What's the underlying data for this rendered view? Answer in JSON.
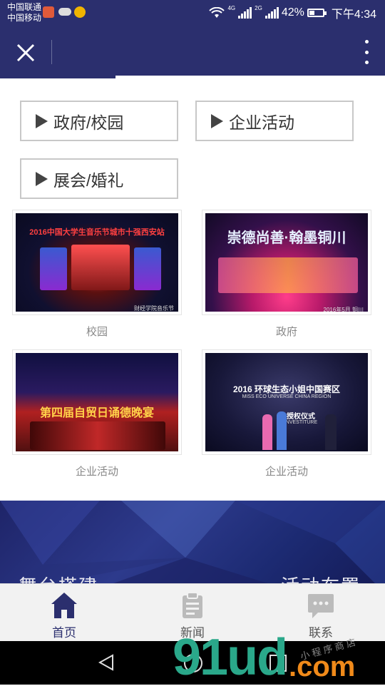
{
  "status_bar": {
    "carrier1": "中国联通",
    "carrier2": "中国移动",
    "net1": "4G",
    "net2": "2G",
    "battery": "42%",
    "battery_level": 0.42,
    "time": "下午4:34"
  },
  "nav": {
    "close_icon": "close-icon",
    "more_icon": "more-vertical-icon"
  },
  "categories": [
    {
      "label": "政府/校园",
      "icon": "play-triangle-icon"
    },
    {
      "label": "企业活动",
      "icon": "play-triangle-icon"
    },
    {
      "label": "展会/婚礼",
      "icon": "play-triangle-icon"
    }
  ],
  "gallery": [
    {
      "caption": "校园",
      "photo_text": "2016中国大学生音乐节城市十强西安站",
      "photo_sub": "财经学院音乐节"
    },
    {
      "caption": "政府",
      "photo_text": "崇德尚善·翰墨铜川",
      "photo_sub": "2016年5月 铜川"
    },
    {
      "caption": "企业活动",
      "photo_text": "第四届自贸日诵德晚宴",
      "photo_sub": ""
    },
    {
      "caption": "企业活动",
      "photo_text": "2016 环球生态小姐中国赛区",
      "photo_sub": "MISS ECO UNIVERSE CHINA REGION",
      "photo_sub2": "授权仪式",
      "photo_sub3": "INVESTITURE"
    }
  ],
  "banner": {
    "left_text": "舞台搭建",
    "right_text": "活动布置"
  },
  "tabs": [
    {
      "label": "首页",
      "icon": "home-icon",
      "active": true
    },
    {
      "label": "新闻",
      "icon": "clipboard-icon",
      "active": false
    },
    {
      "label": "联系",
      "icon": "chat-bubble-icon",
      "active": false
    }
  ],
  "watermark": {
    "main": "91ud",
    "suffix": ".com",
    "sub": "小 程 序 商 店"
  },
  "colors": {
    "brand": "#2b2f6e",
    "tab_active": "#2b2f6e",
    "tab_inactive": "#bbbbbb"
  }
}
